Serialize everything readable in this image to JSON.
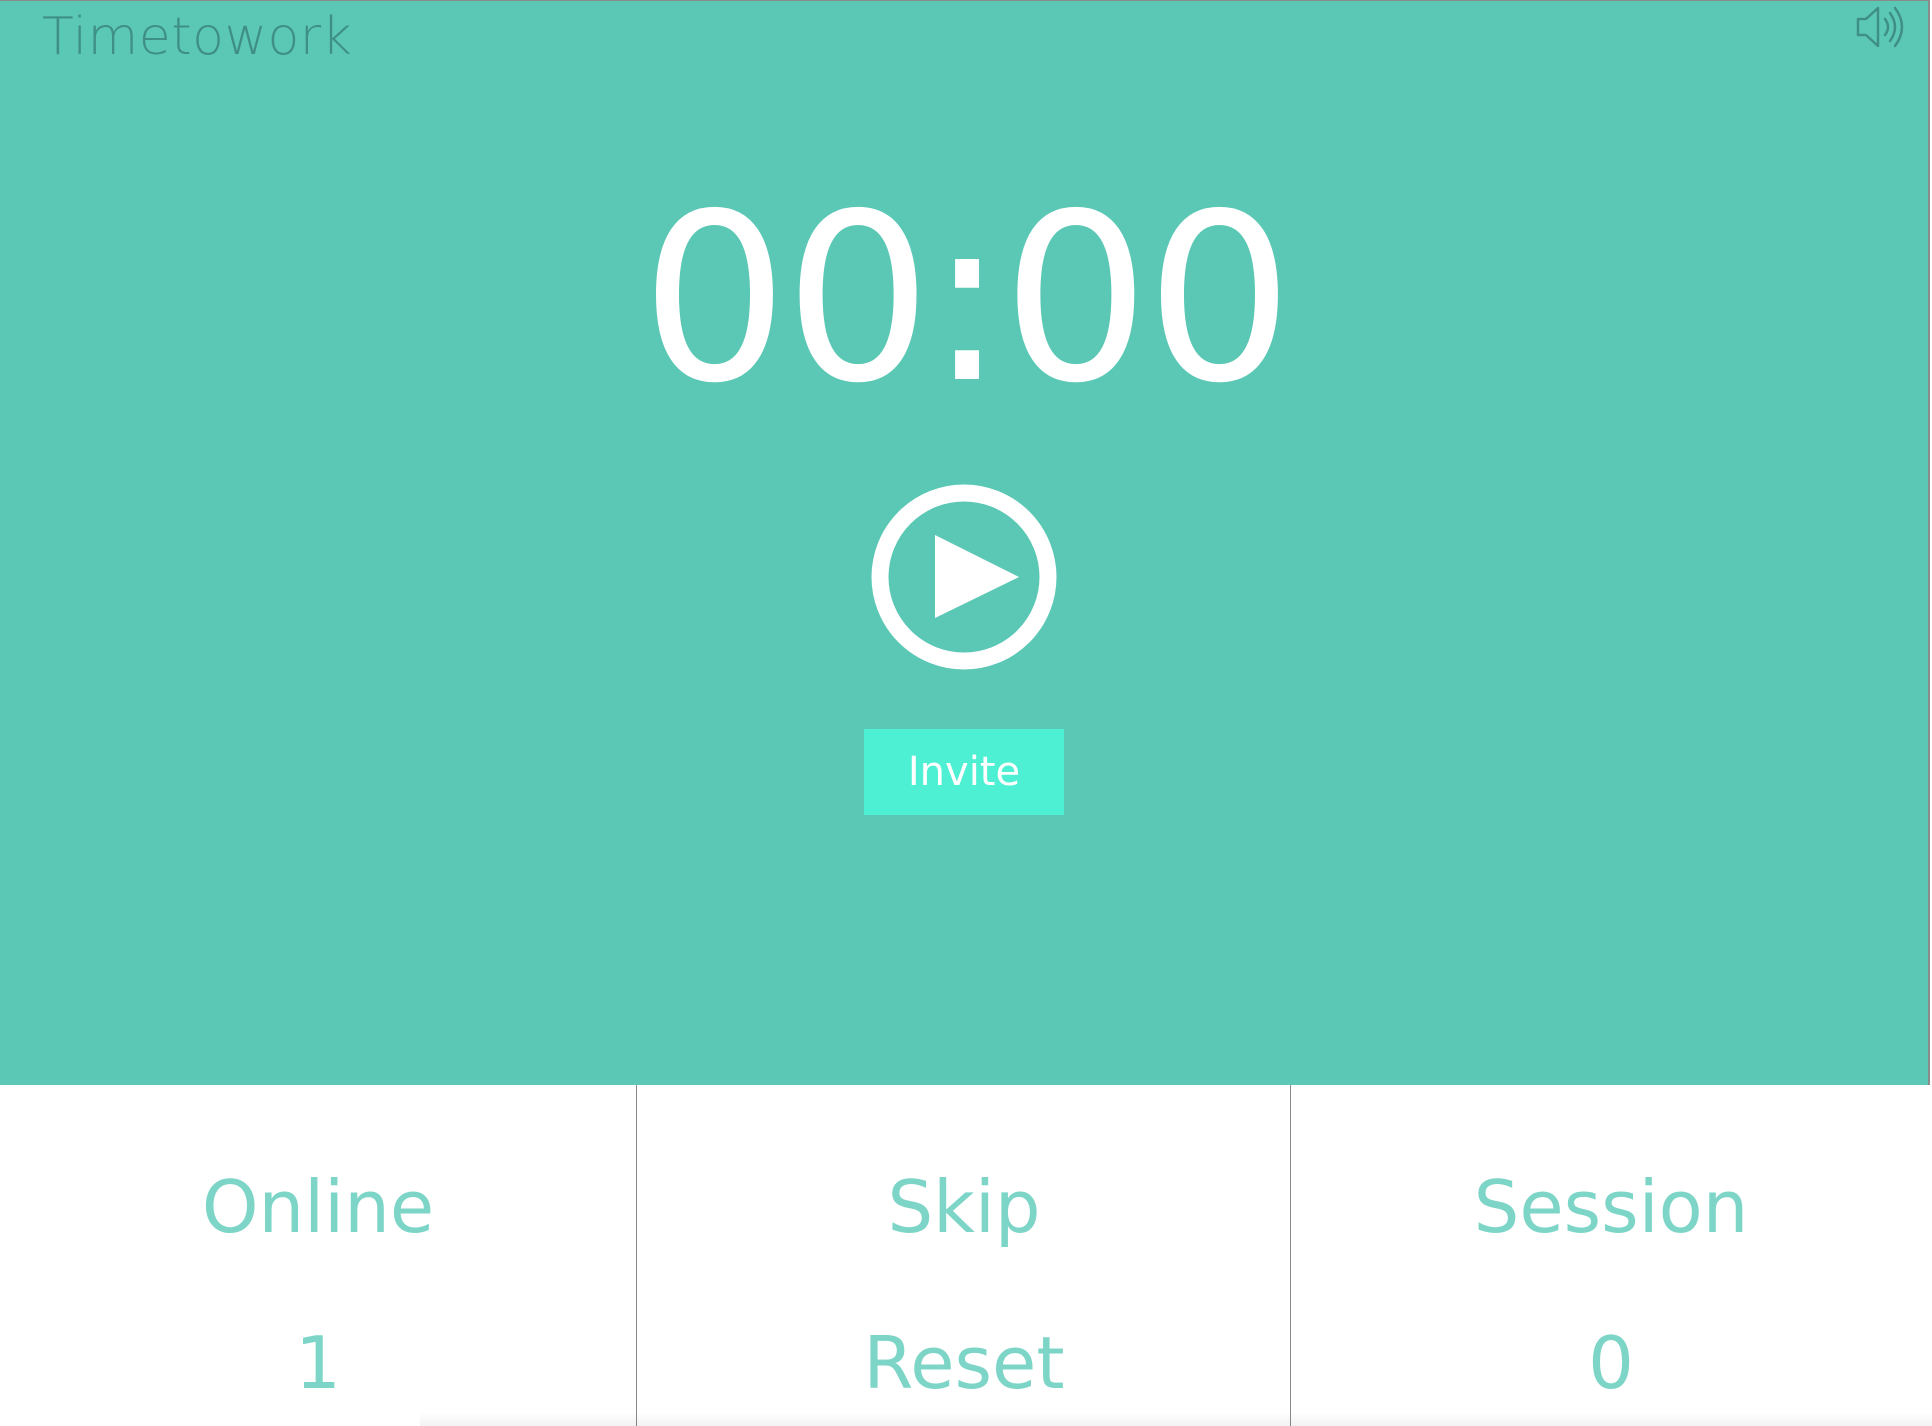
{
  "app": {
    "title": "Timetowork",
    "accent_color": "#5bc8b6",
    "invite_color": "#4df0d2",
    "text_accent": "#7dd5c7"
  },
  "header": {
    "sound_icon": "speaker-icon"
  },
  "timer": {
    "display": "00:00",
    "play_icon": "play-circle-icon"
  },
  "invite": {
    "label": "Invite"
  },
  "stats": {
    "online": {
      "label": "Online",
      "value": "1"
    },
    "controls": {
      "skip_label": "Skip",
      "reset_label": "Reset"
    },
    "session": {
      "label": "Session",
      "value": "0"
    }
  }
}
